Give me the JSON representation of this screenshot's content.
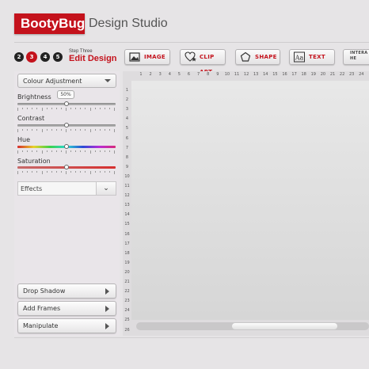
{
  "brand": {
    "bold": "BootyBug",
    "subtitle": "Design Studio"
  },
  "steps": {
    "numbers": [
      "2",
      "3",
      "4",
      "5"
    ],
    "active": "3",
    "label_small": "Step Three",
    "label_main": "Edit Design"
  },
  "toolbar": {
    "image": "IMAGE",
    "clipart": "CLIP ART",
    "shape": "SHAPE",
    "text": "TEXT",
    "interactive": "INTERA HE"
  },
  "panel": {
    "dropdown": "Colour Adjustment",
    "sliders": {
      "brightness": {
        "label": "Brightness",
        "value": 0.5,
        "tooltip": "50%"
      },
      "contrast": {
        "label": "Contrast",
        "value": 0.5
      },
      "hue": {
        "label": "Hue",
        "value": 0.5
      },
      "saturation": {
        "label": "Saturation",
        "value": 0.5
      }
    },
    "effects": "Effects",
    "buttons": [
      "Drop Shadow",
      "Add Frames",
      "Manipulate"
    ]
  },
  "ruler": {
    "top": [
      "1",
      "2",
      "3",
      "4",
      "5",
      "6",
      "7",
      "8",
      "9",
      "10",
      "11",
      "12",
      "13",
      "14",
      "15",
      "16",
      "17",
      "18",
      "19",
      "20",
      "21",
      "22",
      "23",
      "24"
    ],
    "left": [
      "1",
      "2",
      "3",
      "4",
      "5",
      "6",
      "7",
      "8",
      "9",
      "10",
      "11",
      "12",
      "13",
      "14",
      "15",
      "16",
      "17",
      "18",
      "19",
      "20",
      "21",
      "22",
      "23",
      "24",
      "25",
      "26"
    ]
  },
  "colors": {
    "brand_red": "#c4121c"
  }
}
